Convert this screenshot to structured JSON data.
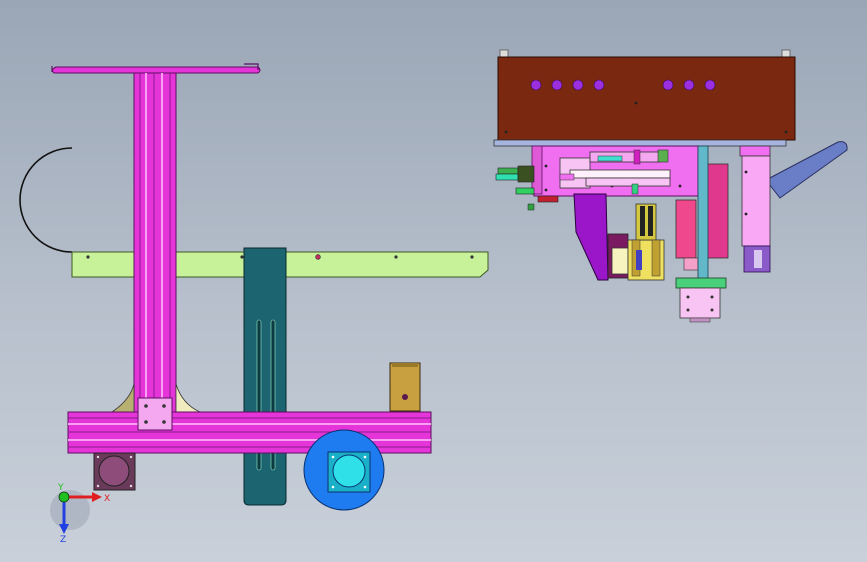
{
  "viewport": {
    "background_top": "#9aa6b6",
    "background_bottom": "#c9d0da"
  },
  "colors": {
    "magenta_frame": "#e535d8",
    "light_green_bar": "#c7f29a",
    "dark_teal_plate": "#1c6470",
    "brown_box": "#7a2810",
    "violet_holes": "#9b2fe0",
    "blue_wheel": "#1e7cf0",
    "cyan_motor": "#2fe0e8",
    "mauve_motor": "#8e4c7a",
    "olive_bracket": "#c8a040",
    "pink_light": "#f4a8f0",
    "purple_dark": "#9a16c8",
    "steel_blue_rod": "#6a7ec8"
  },
  "parts": {
    "left_frame": {
      "vertical_beam": "vertical-extrusion",
      "horizontal_beam": "horizontal-extrusion",
      "top_hook": "wire-hook",
      "arc_guide": "semicircle-guide",
      "cross_bar": "cross-bar",
      "slotted_plate": "slotted-plate",
      "drive_wheel": "drive-wheel",
      "motor": "gear-motor",
      "bracket": "mount-bracket"
    },
    "right_assembly": {
      "control_box": "control-box",
      "cylinder_stack": "cylinder-stack",
      "gripper": "gripper-head",
      "chute": "inclined-chute",
      "base_flange": "base-flange"
    }
  },
  "triad": {
    "x_label": "X",
    "y_label": "Y",
    "z_label": "Z",
    "x_color": "#e02020",
    "y_color": "#20c020",
    "z_color": "#2040e0"
  }
}
